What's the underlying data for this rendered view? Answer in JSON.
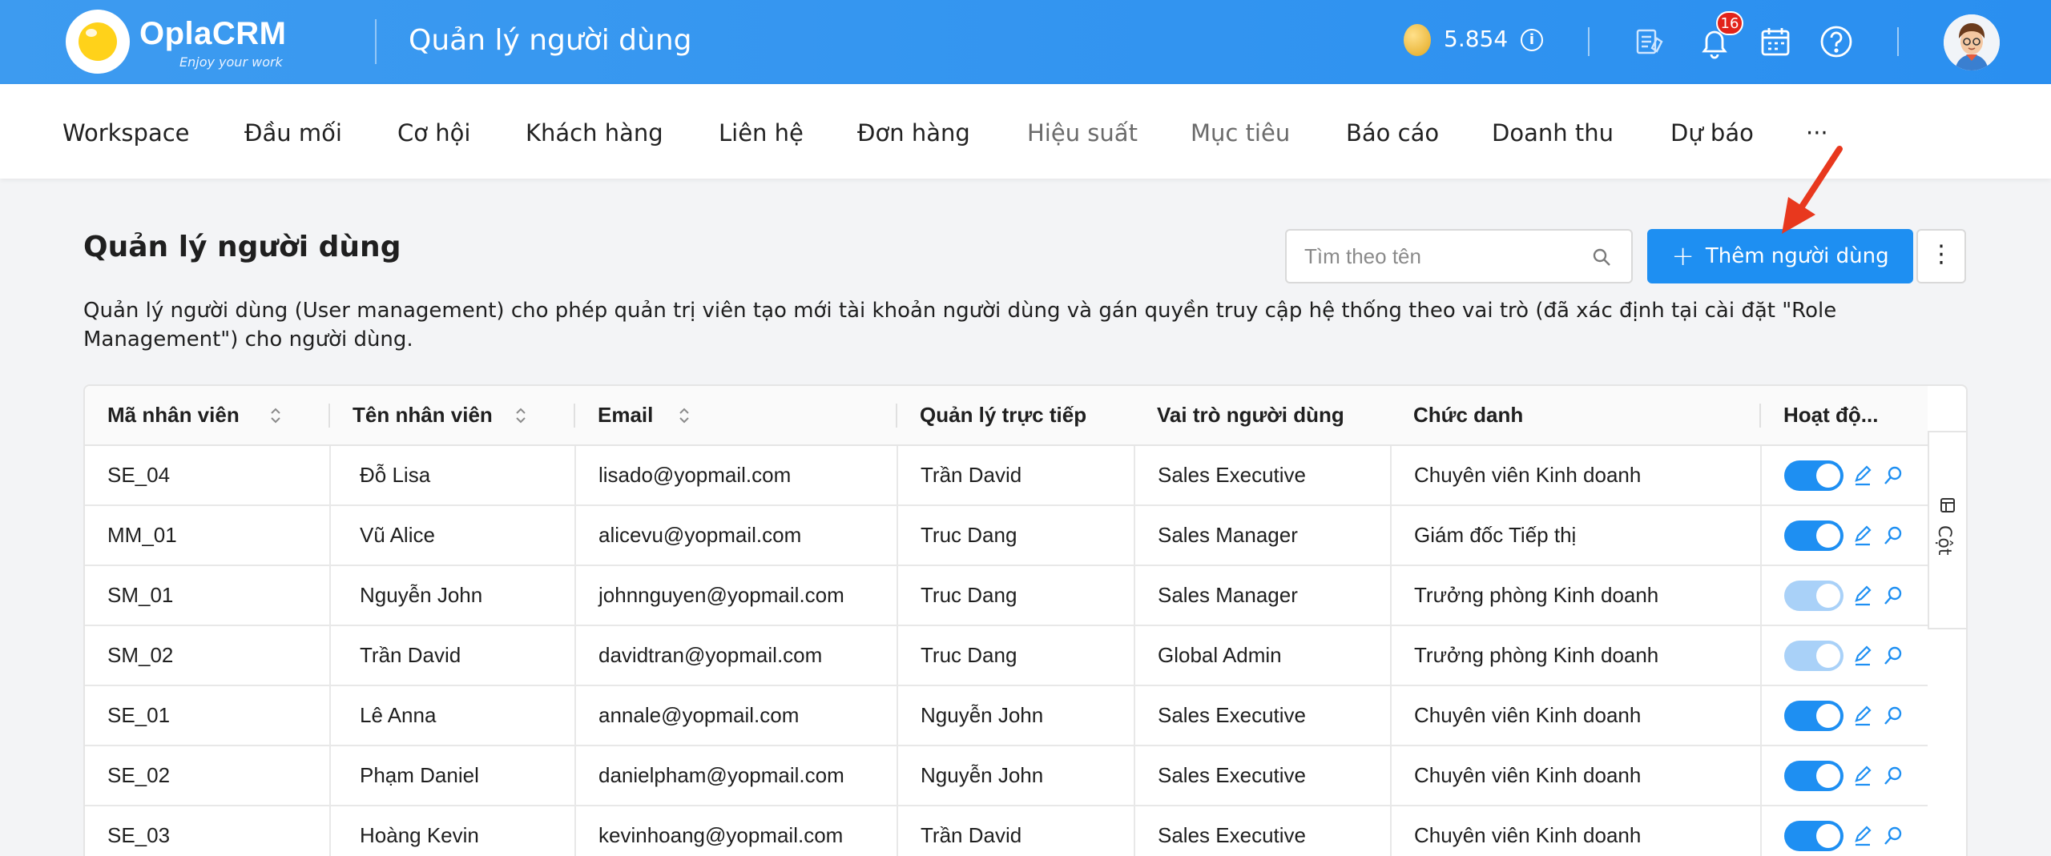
{
  "header": {
    "logo_text": "OplaCRM",
    "logo_tagline": "Enjoy your work",
    "title": "Quản lý người dùng",
    "coins": "5.854",
    "info_glyph": "i",
    "notification_count": "16",
    "icons": [
      "coin-icon",
      "info-icon",
      "report-icon",
      "bell-icon",
      "calendar-icon",
      "help-icon"
    ]
  },
  "nav": {
    "items": [
      "Workspace",
      "Đầu mối",
      "Cơ hội",
      "Khách hàng",
      "Liên hệ",
      "Đơn hàng",
      "Hiệu suất",
      "Mục tiêu",
      "Báo cáo",
      "Doanh thu",
      "Dự báo"
    ],
    "more": "···"
  },
  "page": {
    "title": "Quản lý người dùng",
    "search_placeholder": "Tìm theo tên",
    "add_button": "Thêm người dùng",
    "more_button": "⋮",
    "description": "Quản lý người dùng (User management) cho phép quản trị viên tạo mới tài khoản người dùng và gán quyền truy cập hệ thống theo vai trò (đã xác định tại cài đặt \"Role Management\") cho người dùng."
  },
  "table": {
    "columns": [
      "Mã nhân viên",
      "Tên nhân viên",
      "Email",
      "Quản lý trực tiếp",
      "Vai trò người dùng",
      "Chức danh",
      "Hoạt độ..."
    ],
    "rows": [
      {
        "id": "SE_04",
        "name": "Đỗ Lisa",
        "email": "lisado@yopmail.com",
        "manager": "Trần David",
        "role": "Sales Executive",
        "title": "Chuyên viên Kinh doanh",
        "active": true,
        "enabled": true
      },
      {
        "id": "MM_01",
        "name": "Vũ Alice",
        "email": "alicevu@yopmail.com",
        "manager": "Truc Dang",
        "role": "Sales Manager",
        "title": "Giám đốc Tiếp thị",
        "active": true,
        "enabled": true
      },
      {
        "id": "SM_01",
        "name": "Nguyễn John",
        "email": "johnnguyen@yopmail.com",
        "manager": "Truc Dang",
        "role": "Sales Manager",
        "title": "Trưởng phòng Kinh doanh",
        "active": true,
        "enabled": false
      },
      {
        "id": "SM_02",
        "name": "Trần David",
        "email": "davidtran@yopmail.com",
        "manager": "Truc Dang",
        "role": "Global Admin",
        "title": "Trưởng phòng Kinh doanh",
        "active": true,
        "enabled": false
      },
      {
        "id": "SE_01",
        "name": "Lê Anna",
        "email": "annale@yopmail.com",
        "manager": "Nguyễn John",
        "role": "Sales Executive",
        "title": "Chuyên viên Kinh doanh",
        "active": true,
        "enabled": true
      },
      {
        "id": "SE_02",
        "name": "Phạm Daniel",
        "email": "danielpham@yopmail.com",
        "manager": "Nguyễn John",
        "role": "Sales Executive",
        "title": "Chuyên viên Kinh doanh",
        "active": true,
        "enabled": true
      },
      {
        "id": "SE_03",
        "name": "Hoàng Kevin",
        "email": "kevinhoang@yopmail.com",
        "manager": "Trần David",
        "role": "Sales Executive",
        "title": "Chuyên viên Kinh doanh",
        "active": true,
        "enabled": true
      }
    ],
    "column_panel_label": "Cột"
  },
  "colors": {
    "primary": "#1e8ff2",
    "header_bg": "#3d9bf0",
    "badge": "#e2231a",
    "arrow": "#e8381e"
  }
}
